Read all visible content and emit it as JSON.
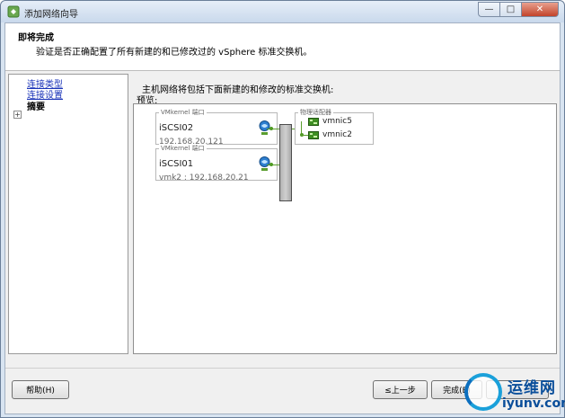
{
  "window": {
    "title": "添加网络向导"
  },
  "header": {
    "title": "即将完成",
    "subtitle": "验证是否正确配置了所有新建的和已修改过的 vSphere 标准交换机。"
  },
  "nav": {
    "items": [
      {
        "label": "连接类型",
        "state": "link"
      },
      {
        "label": "连接设置",
        "state": "link"
      },
      {
        "label": "摘要",
        "state": "current"
      }
    ]
  },
  "main": {
    "caption": "主机网络将包括下面新建的和修改的标准交换机:",
    "preview_label": "预览:"
  },
  "diagram": {
    "port_groups": [
      {
        "legend": "VMkernel 端口",
        "name": "iSCSI02",
        "detail": "192.168.20.121"
      },
      {
        "legend": "VMkernel 端口",
        "name": "iSCSI01",
        "detail": "vmk2 : 192.168.20.21"
      }
    ],
    "adapters": {
      "legend": "物理适配器",
      "items": [
        "vmnic5",
        "vmnic2"
      ]
    },
    "colors": {
      "link": "#4e9a22",
      "switch": "#bdbdbd"
    }
  },
  "buttons": {
    "help": "帮助(H)",
    "back": "≤上一步",
    "finish": "完成(E)",
    "cancel": ""
  },
  "watermark": {
    "line1": "运维网",
    "line2": "iyunv.com"
  }
}
